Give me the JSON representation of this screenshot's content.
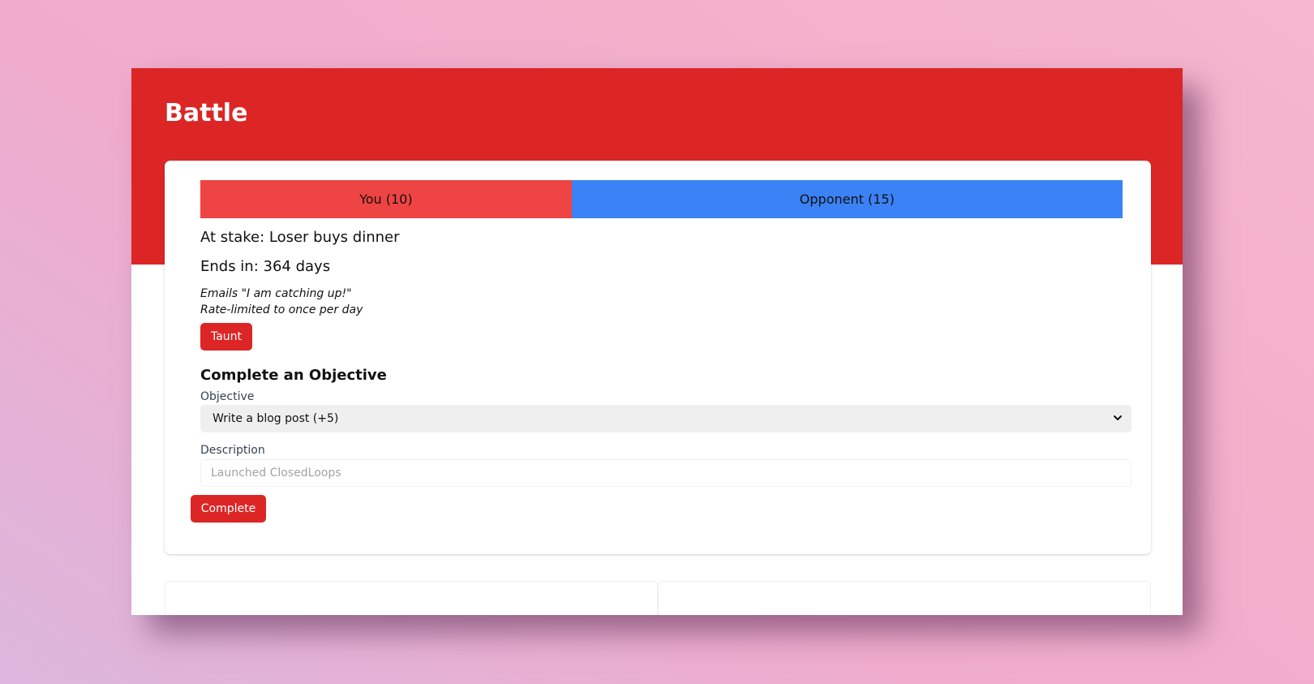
{
  "header": {
    "title": "Battle"
  },
  "score": {
    "you_label": "You (10)",
    "you_points": 10,
    "opponent_label": "Opponent (15)",
    "opponent_points": 15,
    "you_color": "#ef4444",
    "opponent_color": "#3b82f6"
  },
  "battle": {
    "stake": "At stake: Loser buys dinner",
    "ends_in": "Ends in: 364 days",
    "taunt_note_line1": "Emails \"I am catching up!\"",
    "taunt_note_line2": "Rate-limited to once per day",
    "taunt_label": "Taunt"
  },
  "objective_form": {
    "heading": "Complete an Objective",
    "objective_label": "Objective",
    "objective_selected": "Write a blog post (+5)",
    "description_label": "Description",
    "description_placeholder": "Launched ClosedLoops",
    "description_value": "",
    "submit_label": "Complete"
  },
  "colors": {
    "accent": "#dc2626",
    "background_gradient_start": "#dcb6dc",
    "background_gradient_end": "#f6b6cf"
  },
  "icons": {
    "select_arrow": "chevron-down-icon"
  }
}
